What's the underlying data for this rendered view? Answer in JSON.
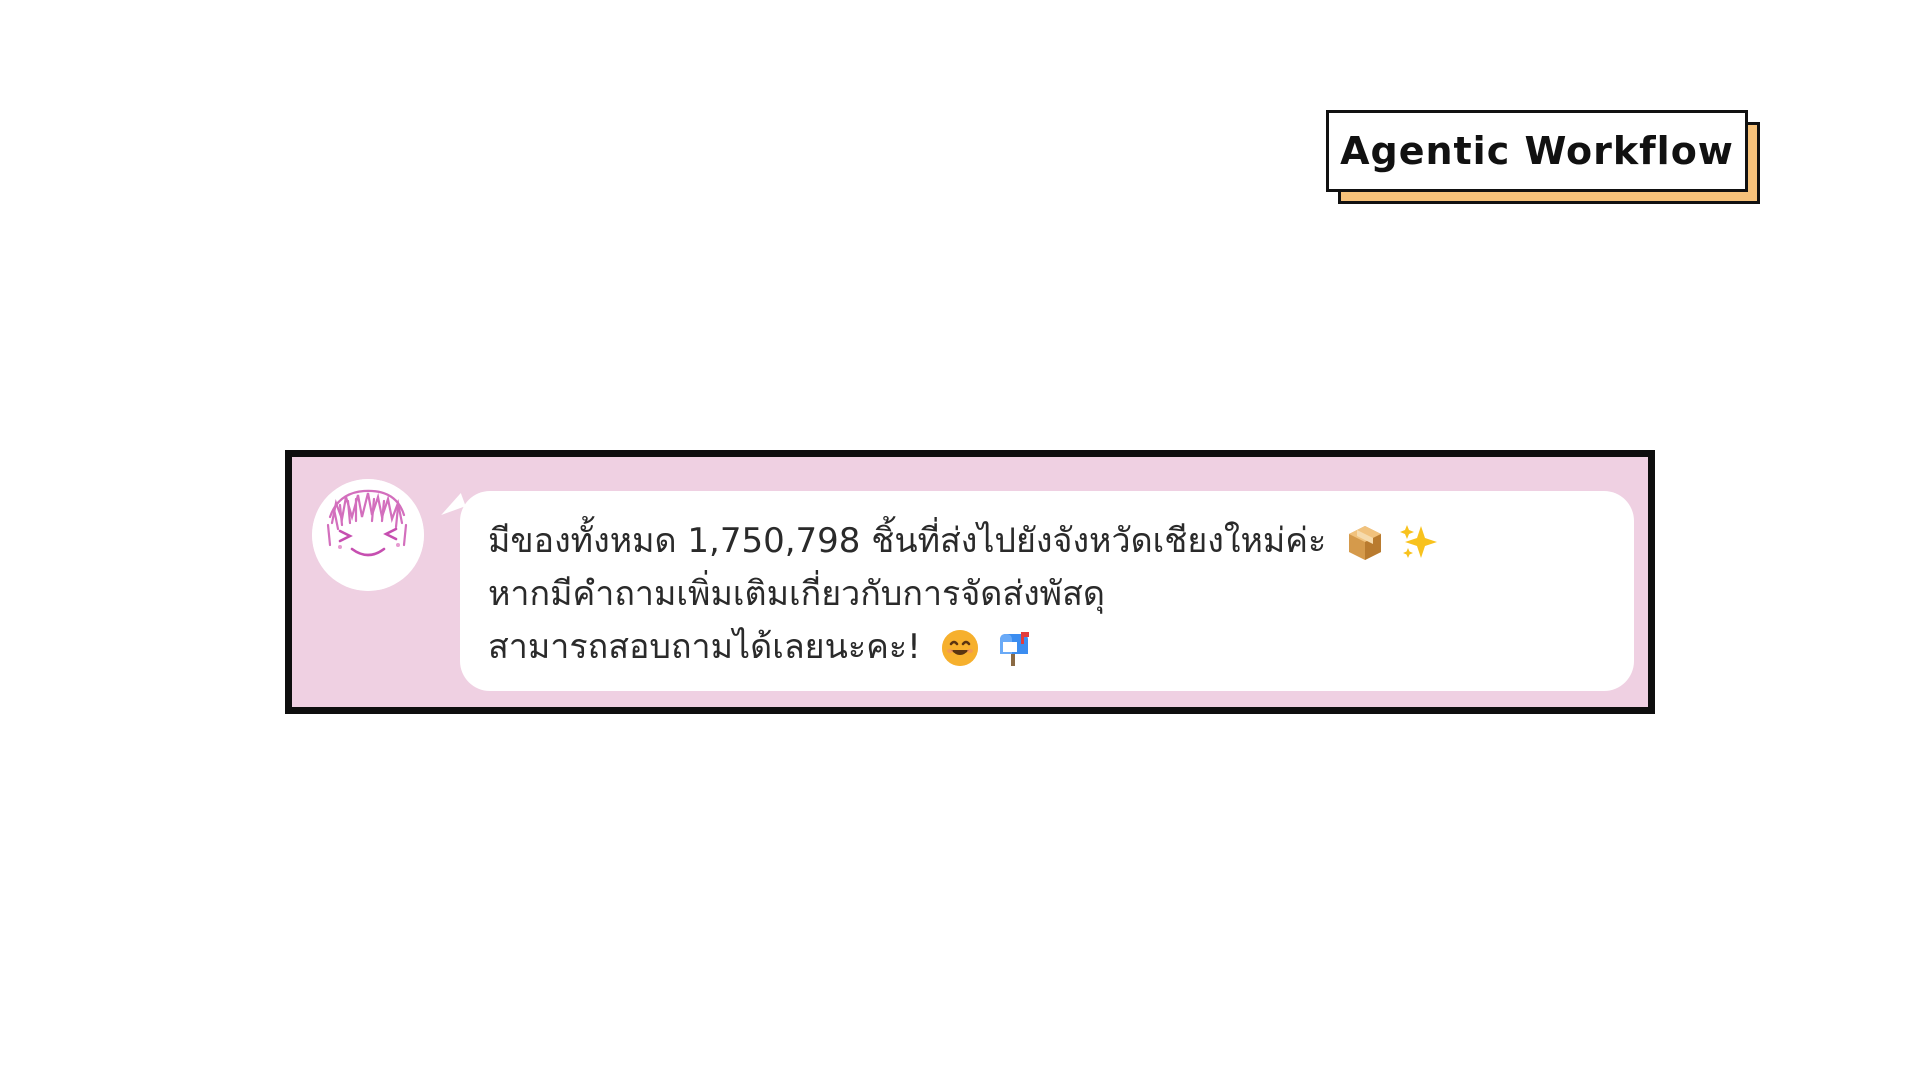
{
  "badge": {
    "label": "Agentic Workflow"
  },
  "chat": {
    "message": {
      "line1": "มีของทั้งหมด 1,750,798 ชิ้นที่ส่งไปยังจังหวัดเชียงใหม่ค่ะ",
      "line2": "หากมีคำถามเพิ่มเติมเกี่ยวกับการจัดส่งพัสดุ",
      "line3": "สามารถสอบถามได้เลยนะคะ!",
      "line1_emojis": [
        "package-icon",
        "sparkles-icon"
      ],
      "line3_emojis": [
        "smiling-face-icon",
        "mailbox-icon"
      ]
    },
    "avatar": "anime-girl-sketch-avatar"
  },
  "colors": {
    "panel_bg": "#efd0e2",
    "panel_border": "#0e0e0e",
    "bubble_bg": "#ffffff",
    "badge_shadow": "#f7c27a"
  }
}
